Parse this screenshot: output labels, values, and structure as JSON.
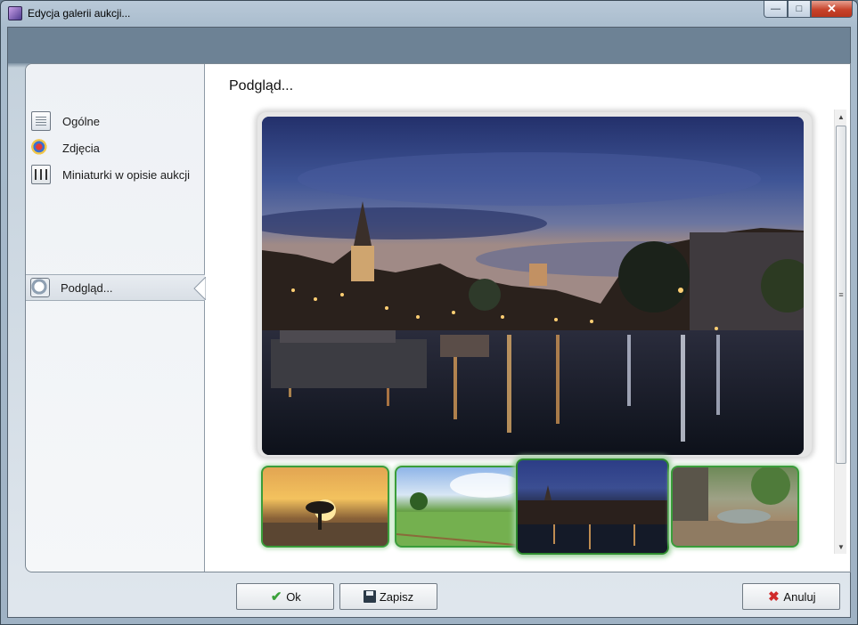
{
  "window": {
    "title": "Edycja galerii aukcji..."
  },
  "titlebar_buttons": {
    "minimize": "—",
    "maximize": "□",
    "close": "✕"
  },
  "sidebar": {
    "items": [
      {
        "label": "Ogólne",
        "icon": "document-icon"
      },
      {
        "label": "Zdjęcia",
        "icon": "photos-icon"
      },
      {
        "label": "Miniaturki w opisie aukcji",
        "icon": "thumbnails-icon"
      }
    ],
    "selected": {
      "label": "Podgląd...",
      "icon": "magnifier-icon"
    }
  },
  "content": {
    "title": "Podgląd...",
    "main_image": "night-river-city-photo",
    "thumbnails": [
      {
        "name": "sunset-tree-thumbnail",
        "active": false
      },
      {
        "name": "green-meadow-thumbnail",
        "active": false
      },
      {
        "name": "night-river-city-thumbnail",
        "active": true
      },
      {
        "name": "rocky-stream-thumbnail",
        "active": false
      }
    ]
  },
  "scrollbar": {
    "up": "▲",
    "grip": "≡",
    "down": "▼"
  },
  "buttons": {
    "ok": "Ok",
    "save": "Zapisz",
    "cancel": "Anuluj",
    "ok_icon": "✔",
    "cancel_icon": "✖"
  },
  "colors": {
    "accent_green": "#3a9d3a",
    "cancel_red": "#d02b2b"
  }
}
